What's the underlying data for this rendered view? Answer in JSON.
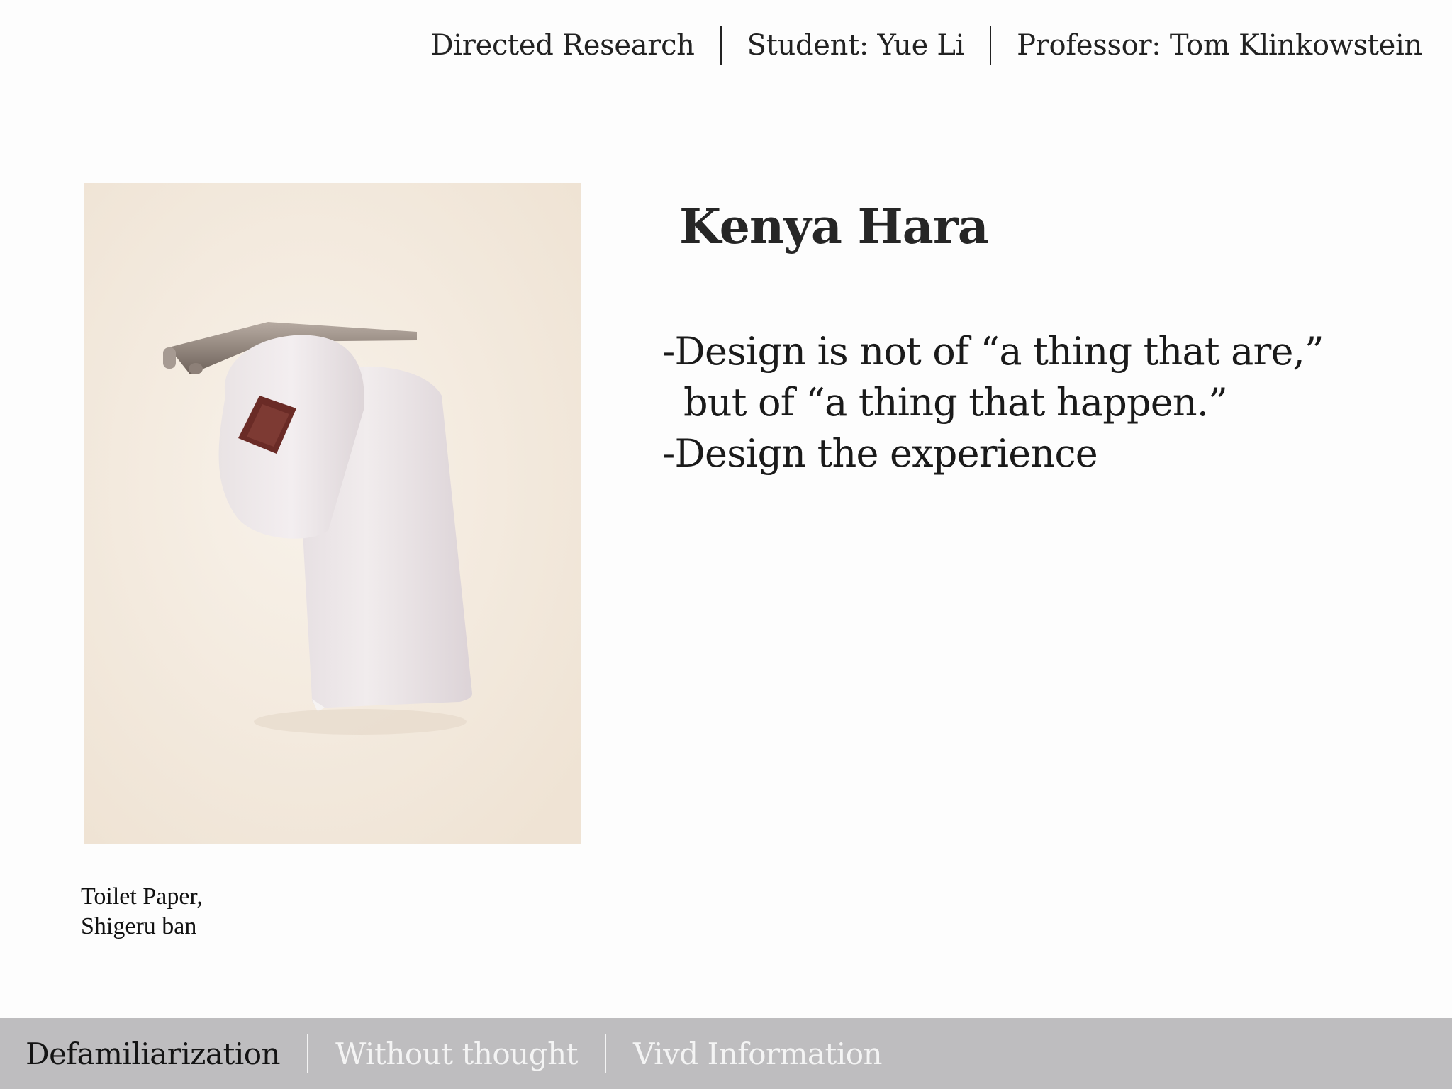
{
  "header": {
    "course": "Directed Research",
    "student": "Student: Yue Li",
    "professor": "Professor: Tom Klinkowstein"
  },
  "figure": {
    "caption_line1": "Toilet Paper,",
    "caption_line2": "Shigeru ban"
  },
  "main": {
    "title": "Kenya Hara",
    "points": [
      "-Design is not of “a thing that are,”",
      "but of “a thing that happen.”",
      "-Design the experience"
    ]
  },
  "bottom_nav": {
    "tabs": [
      {
        "label": "Defamiliarization",
        "active": true
      },
      {
        "label": "Without thought",
        "active": false
      },
      {
        "label": "Vivd Information",
        "active": false
      }
    ]
  }
}
